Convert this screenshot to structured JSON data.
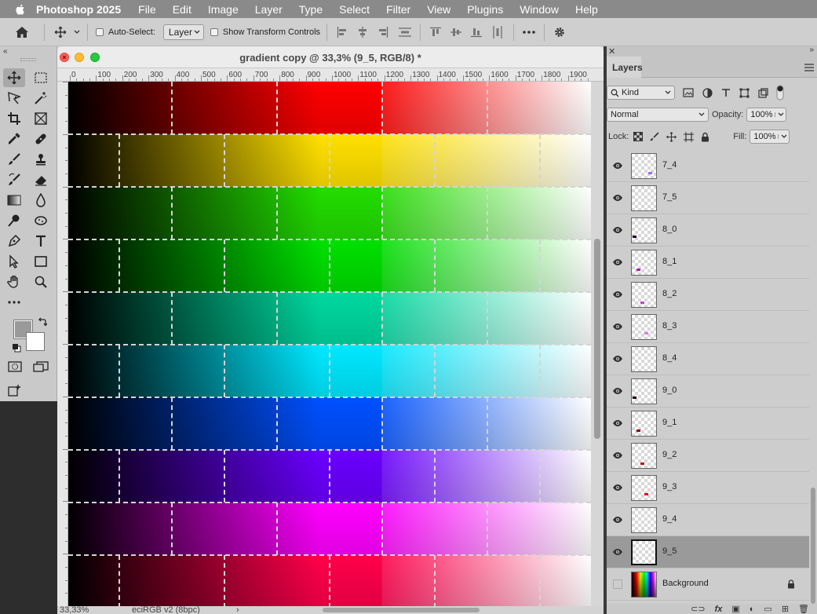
{
  "menubar": {
    "app_name": "Photoshop 2025",
    "items": [
      "File",
      "Edit",
      "Image",
      "Layer",
      "Type",
      "Select",
      "Filter",
      "View",
      "Plugins",
      "Window",
      "Help"
    ]
  },
  "options_bar": {
    "auto_select_label": "Auto-Select:",
    "auto_select_value": "Layer",
    "auto_select_checked": false,
    "show_transform_label": "Show Transform Controls",
    "show_transform_checked": false
  },
  "toolbar": {
    "collapse_glyph": "«",
    "tools": [
      {
        "icon": "move-tool-icon",
        "active": true
      },
      {
        "icon": "rectangular-marquee-icon"
      },
      {
        "icon": "lasso-icon"
      },
      {
        "icon": "magic-wand-icon"
      },
      {
        "icon": "crop-icon"
      },
      {
        "icon": "frame-icon"
      },
      {
        "icon": "eyedropper-icon"
      },
      {
        "icon": "healing-brush-icon"
      },
      {
        "icon": "brush-icon"
      },
      {
        "icon": "clone-stamp-icon"
      },
      {
        "icon": "history-brush-icon"
      },
      {
        "icon": "eraser-icon"
      },
      {
        "icon": "gradient-icon"
      },
      {
        "icon": "blur-icon"
      },
      {
        "icon": "dodge-icon"
      },
      {
        "icon": "sponge-icon"
      },
      {
        "icon": "pen-icon"
      },
      {
        "icon": "type-icon"
      },
      {
        "icon": "path-selection-icon"
      },
      {
        "icon": "rectangle-shape-icon"
      },
      {
        "icon": "hand-icon"
      },
      {
        "icon": "zoom-icon"
      },
      {
        "icon": "more-tools-icon"
      }
    ],
    "foreground_color": "#9a9a9a",
    "background_color": "#ffffff"
  },
  "document": {
    "title": "gradient copy @ 33,3% (9_5, RGB/8) *",
    "ruler_labels": [
      "0",
      "100",
      "200",
      "300",
      "400",
      "500",
      "600",
      "700",
      "800",
      "900",
      "1000",
      "1100",
      "1200",
      "1300",
      "1400",
      "1500",
      "1600",
      "1700",
      "1800",
      "1900"
    ],
    "zoom_status": "33,33%",
    "profile_status": "eciRGB v2 (8bpc)",
    "status_arrow": "›",
    "rows": [
      {
        "hue": "red",
        "color": "#ff0000"
      },
      {
        "hue": "yellow",
        "color": "#ffe000"
      },
      {
        "hue": "green-yellow",
        "color": "#22dd00"
      },
      {
        "hue": "green",
        "color": "#00e000"
      },
      {
        "hue": "teal",
        "color": "#00d8a0"
      },
      {
        "hue": "cyan",
        "color": "#00e8ff"
      },
      {
        "hue": "blue",
        "color": "#0050ff"
      },
      {
        "hue": "violet",
        "color": "#6a00ff"
      },
      {
        "hue": "magenta",
        "color": "#ff00ff"
      },
      {
        "hue": "rose",
        "color": "#ff004a"
      }
    ]
  },
  "layers_panel": {
    "tab_label": "Layers",
    "filter_kind": "Kind",
    "blend_mode": "Normal",
    "opacity_label": "Opacity:",
    "opacity_value": "100%",
    "lock_label": "Lock:",
    "fill_label": "Fill:",
    "fill_value": "100%",
    "layers": [
      {
        "name": "7_4",
        "visible": true,
        "mark": "#9b6bff"
      },
      {
        "name": "7_5",
        "visible": true,
        "mark": ""
      },
      {
        "name": "8_0",
        "visible": true,
        "mark": "#2a0030"
      },
      {
        "name": "8_1",
        "visible": true,
        "mark": "#b31bb3"
      },
      {
        "name": "8_2",
        "visible": true,
        "mark": "#c740d6"
      },
      {
        "name": "8_3",
        "visible": true,
        "mark": "#d77ce0"
      },
      {
        "name": "8_4",
        "visible": true,
        "mark": ""
      },
      {
        "name": "9_0",
        "visible": true,
        "mark": "#220000"
      },
      {
        "name": "9_1",
        "visible": true,
        "mark": "#8a0010"
      },
      {
        "name": "9_2",
        "visible": true,
        "mark": "#c0101a"
      },
      {
        "name": "9_3",
        "visible": true,
        "mark": "#e0102a"
      },
      {
        "name": "9_4",
        "visible": true,
        "mark": ""
      },
      {
        "name": "9_5",
        "visible": true,
        "mark": "",
        "selected": true
      },
      {
        "name": "Background",
        "visible": false,
        "mark": "",
        "background": true,
        "locked": true
      }
    ],
    "bottom_fx_label": "fx"
  }
}
